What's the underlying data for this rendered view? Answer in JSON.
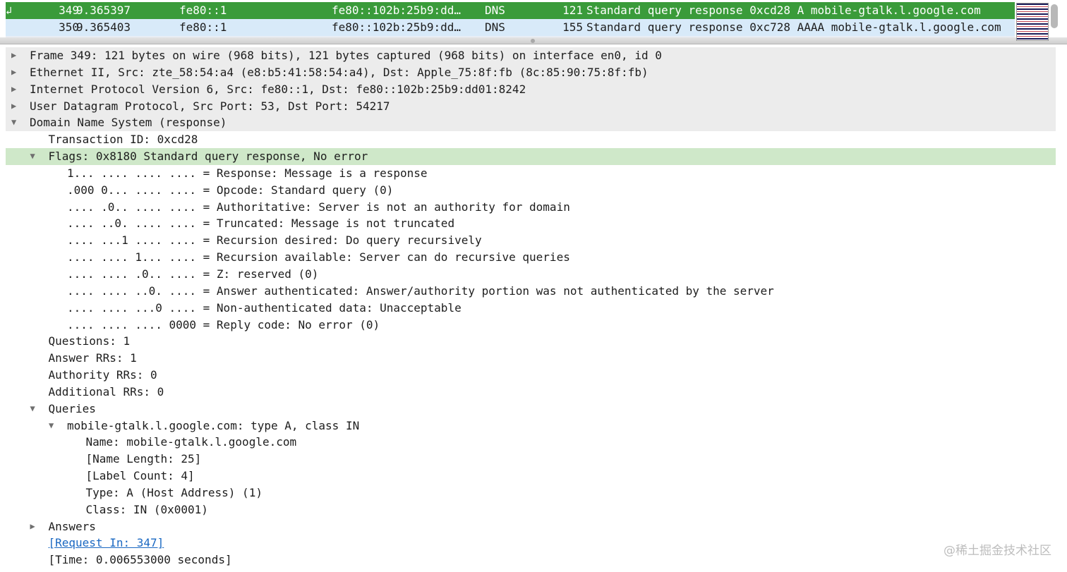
{
  "packet_list": {
    "rows": [
      {
        "no": "349",
        "time": "9.365397",
        "src": "fe80::1",
        "dst": "fe80::102b:25b9:dd…",
        "proto": "DNS",
        "len": "121",
        "info": "Standard query response 0xcd28 A mobile-gtalk.l.google.com",
        "style": "sel",
        "icon": "↲"
      },
      {
        "no": "350",
        "time": "9.365403",
        "src": "fe80::1",
        "dst": "fe80::102b:25b9:dd…",
        "proto": "DNS",
        "len": "155",
        "info": "Standard query response 0xc728 AAAA mobile-gtalk.l.google.com",
        "style": "alt",
        "icon": ""
      }
    ]
  },
  "details": {
    "rows": [
      {
        "level": 0,
        "arrow": "▶",
        "text": "Frame 349: 121 bytes on wire (968 bits), 121 bytes captured (968 bits) on interface en0, id 0",
        "style": "hdr"
      },
      {
        "level": 0,
        "arrow": "▶",
        "text": "Ethernet II, Src: zte_58:54:a4 (e8:b5:41:58:54:a4), Dst: Apple_75:8f:fb (8c:85:90:75:8f:fb)",
        "style": "hdr"
      },
      {
        "level": 0,
        "arrow": "▶",
        "text": "Internet Protocol Version 6, Src: fe80::1, Dst: fe80::102b:25b9:dd01:8242",
        "style": "hdr"
      },
      {
        "level": 0,
        "arrow": "▶",
        "text": "User Datagram Protocol, Src Port: 53, Dst Port: 54217",
        "style": "hdr"
      },
      {
        "level": 0,
        "arrow": "▼",
        "text": "Domain Name System (response)",
        "style": "hdr"
      },
      {
        "level": 1,
        "arrow": "",
        "text": "Transaction ID: 0xcd28",
        "style": ""
      },
      {
        "level": 1,
        "arrow": "▼",
        "text": "Flags: 0x8180 Standard query response, No error",
        "style": "hl"
      },
      {
        "level": 2,
        "arrow": "",
        "text": "1... .... .... .... = Response: Message is a response",
        "style": ""
      },
      {
        "level": 2,
        "arrow": "",
        "text": ".000 0... .... .... = Opcode: Standard query (0)",
        "style": ""
      },
      {
        "level": 2,
        "arrow": "",
        "text": ".... .0.. .... .... = Authoritative: Server is not an authority for domain",
        "style": ""
      },
      {
        "level": 2,
        "arrow": "",
        "text": ".... ..0. .... .... = Truncated: Message is not truncated",
        "style": ""
      },
      {
        "level": 2,
        "arrow": "",
        "text": ".... ...1 .... .... = Recursion desired: Do query recursively",
        "style": ""
      },
      {
        "level": 2,
        "arrow": "",
        "text": ".... .... 1... .... = Recursion available: Server can do recursive queries",
        "style": ""
      },
      {
        "level": 2,
        "arrow": "",
        "text": ".... .... .0.. .... = Z: reserved (0)",
        "style": ""
      },
      {
        "level": 2,
        "arrow": "",
        "text": ".... .... ..0. .... = Answer authenticated: Answer/authority portion was not authenticated by the server",
        "style": ""
      },
      {
        "level": 2,
        "arrow": "",
        "text": ".... .... ...0 .... = Non-authenticated data: Unacceptable",
        "style": ""
      },
      {
        "level": 2,
        "arrow": "",
        "text": ".... .... .... 0000 = Reply code: No error (0)",
        "style": ""
      },
      {
        "level": 1,
        "arrow": "",
        "text": "Questions: 1",
        "style": ""
      },
      {
        "level": 1,
        "arrow": "",
        "text": "Answer RRs: 1",
        "style": ""
      },
      {
        "level": 1,
        "arrow": "",
        "text": "Authority RRs: 0",
        "style": ""
      },
      {
        "level": 1,
        "arrow": "",
        "text": "Additional RRs: 0",
        "style": ""
      },
      {
        "level": 1,
        "arrow": "▼",
        "text": "Queries",
        "style": ""
      },
      {
        "level": 2,
        "arrow": "▼",
        "text": "mobile-gtalk.l.google.com: type A, class IN",
        "style": ""
      },
      {
        "level": 3,
        "arrow": "",
        "text": "Name: mobile-gtalk.l.google.com",
        "style": ""
      },
      {
        "level": 3,
        "arrow": "",
        "text": "[Name Length: 25]",
        "style": ""
      },
      {
        "level": 3,
        "arrow": "",
        "text": "[Label Count: 4]",
        "style": ""
      },
      {
        "level": 3,
        "arrow": "",
        "text": "Type: A (Host Address) (1)",
        "style": ""
      },
      {
        "level": 3,
        "arrow": "",
        "text": "Class: IN (0x0001)",
        "style": ""
      },
      {
        "level": 1,
        "arrow": "▶",
        "text": "Answers",
        "style": ""
      },
      {
        "level": 1,
        "arrow": "",
        "text": "[Request In: 347]",
        "style": "link"
      },
      {
        "level": 1,
        "arrow": "",
        "text": "[Time: 0.006553000 seconds]",
        "style": ""
      }
    ]
  },
  "watermark": "@稀土掘金技术社区",
  "colors": {
    "selected_row": "#3a9b3a",
    "alt_row": "#d8eaf9",
    "highlight": "#cfe8c9",
    "link": "#1a68c2"
  }
}
